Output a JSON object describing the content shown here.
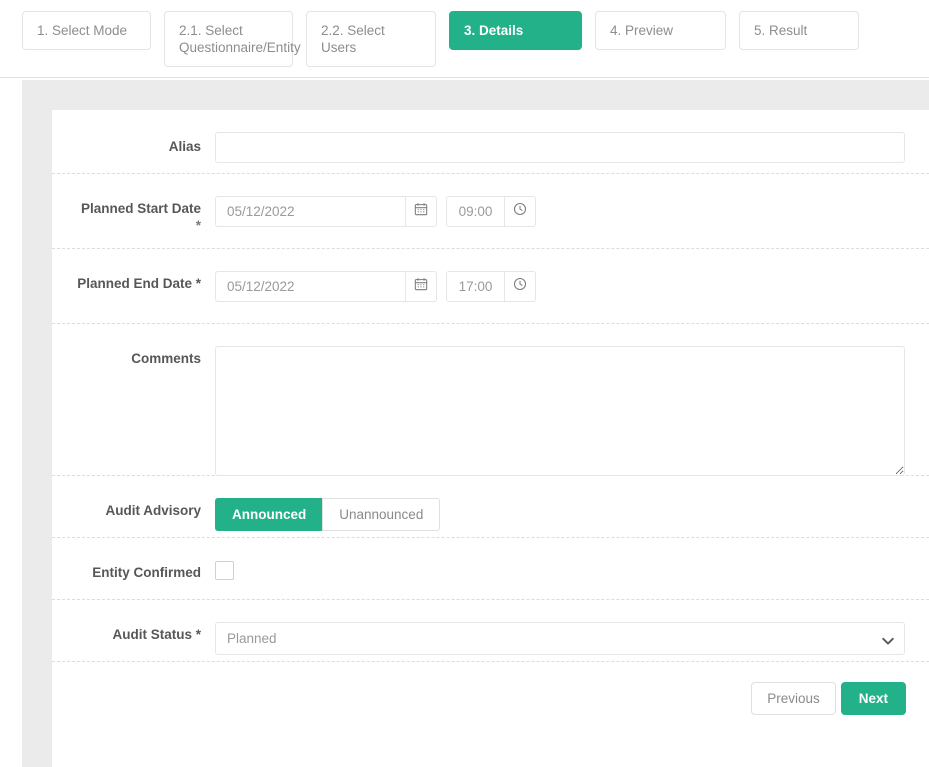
{
  "wizard": {
    "tabs": [
      {
        "label": "1. Select Mode",
        "active": false
      },
      {
        "label": "2.1. Select Questionnaire/Entity",
        "active": false
      },
      {
        "label": "2.2. Select Users",
        "active": false
      },
      {
        "label": "3. Details",
        "active": true
      },
      {
        "label": "4. Preview",
        "active": false
      },
      {
        "label": "5. Result",
        "active": false
      }
    ]
  },
  "form": {
    "alias": {
      "label": "Alias",
      "value": "",
      "placeholder": ""
    },
    "planned_start_date": {
      "label": "Planned Start Date",
      "required_marker": "*",
      "date_value": "05/12/2022",
      "time_value": "09:00",
      "date_icon": "calendar-icon",
      "time_icon": "clock-icon"
    },
    "planned_end_date": {
      "label": "Planned End Date *",
      "date_value": "05/12/2022",
      "time_value": "17:00",
      "date_icon": "calendar-icon",
      "time_icon": "clock-icon"
    },
    "comments": {
      "label": "Comments",
      "value": "",
      "placeholder": ""
    },
    "audit_advisory": {
      "label": "Audit Advisory",
      "options": [
        {
          "label": "Announced",
          "selected": true
        },
        {
          "label": "Unannounced",
          "selected": false
        }
      ]
    },
    "entity_confirmed": {
      "label": "Entity Confirmed",
      "checked": false
    },
    "audit_status": {
      "label": "Audit Status *",
      "value": "Planned",
      "options": [
        "Planned"
      ],
      "icon": "chevron-down-icon"
    }
  },
  "actions": {
    "previous_label": "Previous",
    "next_label": "Next"
  },
  "colors": {
    "accent": "#22b189",
    "label_text": "#575757",
    "muted_text": "#9a9a9a",
    "border": "#e6e6e6",
    "panel_bg": "#ebebeb"
  }
}
